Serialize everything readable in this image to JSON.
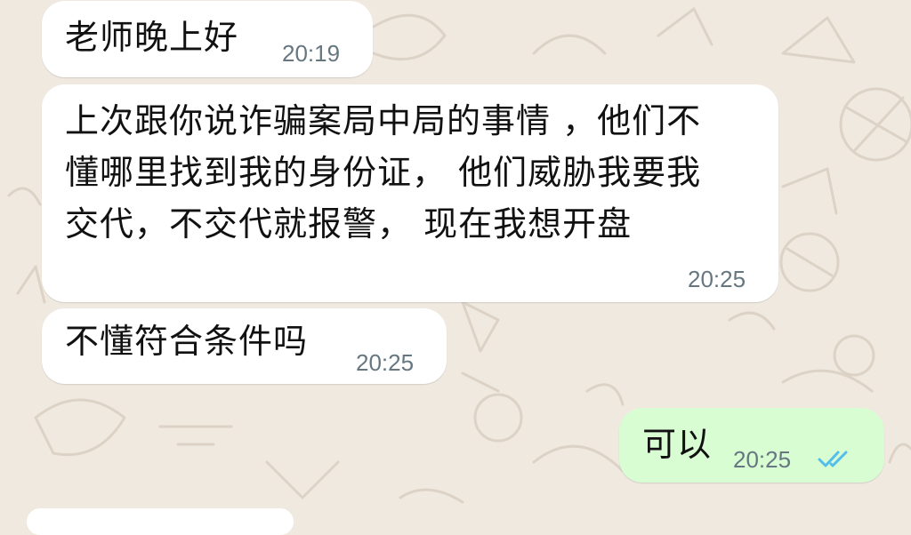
{
  "chat": {
    "messages": [
      {
        "direction": "incoming",
        "text": "老师晚上好",
        "time": "20:19"
      },
      {
        "direction": "incoming",
        "lines": [
          "上次跟你说诈骗案局中局的事情 ，他们不",
          "懂哪里找到我的身份证， 他们威胁我要我",
          "交代，不交代就报警， 现在我想开盘"
        ],
        "time": "20:25"
      },
      {
        "direction": "incoming",
        "text": "不懂符合条件吗",
        "time": "20:25"
      },
      {
        "direction": "outgoing",
        "text": "可以",
        "time": "20:25",
        "status": "read",
        "status_icon": "double-check-icon",
        "status_color": "#53bdeb"
      }
    ]
  },
  "colors": {
    "wallpaper": "#efe9e0",
    "incoming_bubble": "#ffffff",
    "outgoing_bubble": "#d9fdd3",
    "timestamp": "#667781"
  }
}
